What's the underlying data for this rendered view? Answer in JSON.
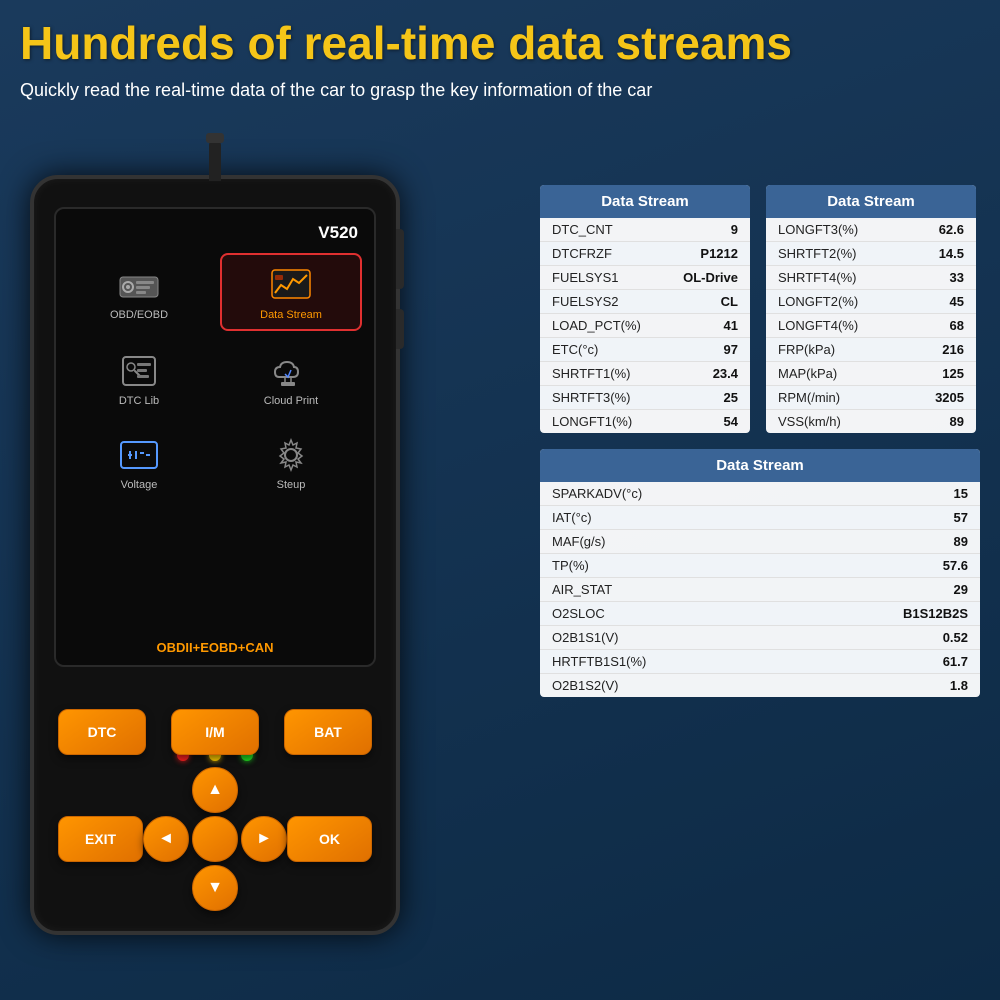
{
  "header": {
    "main_title": "Hundreds of real-time data streams",
    "sub_title": "Quickly read the real-time data of the car to grasp the key information of the car"
  },
  "device": {
    "model": "V520",
    "screen_label": "OBDII+EOBD+CAN",
    "menu_items": [
      {
        "id": "obd",
        "label": "OBD/EOBD",
        "highlighted": false
      },
      {
        "id": "datastream",
        "label": "Data Stream",
        "highlighted": true
      },
      {
        "id": "dtclib",
        "label": "DTC Lib",
        "highlighted": false
      },
      {
        "id": "cloudprint",
        "label": "Cloud Print",
        "highlighted": false
      },
      {
        "id": "voltage",
        "label": "Voltage",
        "highlighted": false
      },
      {
        "id": "steup",
        "label": "Steup",
        "highlighted": false
      }
    ],
    "buttons": {
      "top_row": [
        "DTC",
        "I/M",
        "BAT"
      ],
      "nav": [
        "EXIT",
        "◄",
        "▲",
        "▼",
        "►",
        "OK"
      ]
    }
  },
  "data_tables": {
    "table1": {
      "header": "Data Stream",
      "rows": [
        {
          "key": "DTC_CNT",
          "value": "9"
        },
        {
          "key": "DTCFRZF",
          "value": "P1212"
        },
        {
          "key": "FUELSYS1",
          "value": "OL-Drive"
        },
        {
          "key": "FUELSYS2",
          "value": "CL"
        },
        {
          "key": "LOAD_PCT(%)",
          "value": "41"
        },
        {
          "key": "ETC(°c)",
          "value": "97"
        },
        {
          "key": "SHRTFT1(%)",
          "value": "23.4"
        },
        {
          "key": "SHRTFT3(%)",
          "value": "25"
        },
        {
          "key": "LONGFT1(%)",
          "value": "54"
        }
      ]
    },
    "table2": {
      "header": "Data Stream",
      "rows": [
        {
          "key": "LONGFT3(%)",
          "value": "62.6"
        },
        {
          "key": "SHRTFT2(%)",
          "value": "14.5"
        },
        {
          "key": "SHRTFT4(%)",
          "value": "33"
        },
        {
          "key": "LONGFT2(%)",
          "value": "45"
        },
        {
          "key": "LONGFT4(%)",
          "value": "68"
        },
        {
          "key": "FRP(kPa)",
          "value": "216"
        },
        {
          "key": "MAP(kPa)",
          "value": "125"
        },
        {
          "key": "RPM(/min)",
          "value": "3205"
        },
        {
          "key": "VSS(km/h)",
          "value": "89"
        }
      ]
    },
    "table3": {
      "header": "Data Stream",
      "rows": [
        {
          "key": "SPARKADV(°c)",
          "value": "15"
        },
        {
          "key": "IAT(°c)",
          "value": "57"
        },
        {
          "key": "MAF(g/s)",
          "value": "89"
        },
        {
          "key": "TP(%)",
          "value": "57.6"
        },
        {
          "key": "AIR_STAT",
          "value": "29"
        },
        {
          "key": "O2SLOC",
          "value": "B1S12B2S"
        },
        {
          "key": "O2B1S1(V)",
          "value": "0.52"
        },
        {
          "key": "HRTFTB1S1(%)",
          "value": "61.7"
        },
        {
          "key": "O2B1S2(V)",
          "value": "1.8"
        }
      ]
    }
  }
}
